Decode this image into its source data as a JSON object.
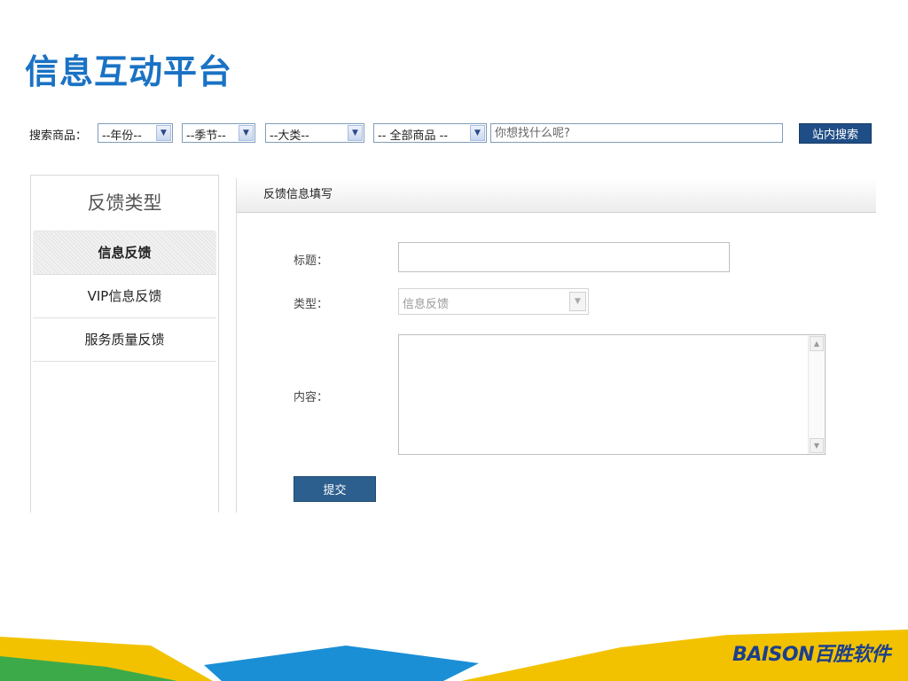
{
  "page_title": "信息互动平台",
  "search": {
    "label": "搜索商品：",
    "year_select": "--年份--",
    "season_select": "--季节--",
    "category_select": "--大类--",
    "product_select": "-- 全部商品 --",
    "placeholder": "你想找什么呢?",
    "button": "站内搜索"
  },
  "sidebar": {
    "title": "反馈类型",
    "items": [
      {
        "label": "信息反馈",
        "active": true
      },
      {
        "label": "VIP信息反馈",
        "active": false
      },
      {
        "label": "服务质量反馈",
        "active": false
      }
    ]
  },
  "form": {
    "header": "反馈信息填写",
    "title_label": "标题：",
    "type_label": "类型：",
    "type_value": "信息反馈",
    "content_label": "内容：",
    "submit": "提交"
  },
  "brand": {
    "logo_text": "BAISON百胜软件"
  },
  "colors": {
    "title_blue": "#1a72c4",
    "button_blue": "#1f4e86",
    "footer_yellow": "#f2c200",
    "footer_blue": "#1a8fd6",
    "footer_green": "#3daa4a"
  }
}
